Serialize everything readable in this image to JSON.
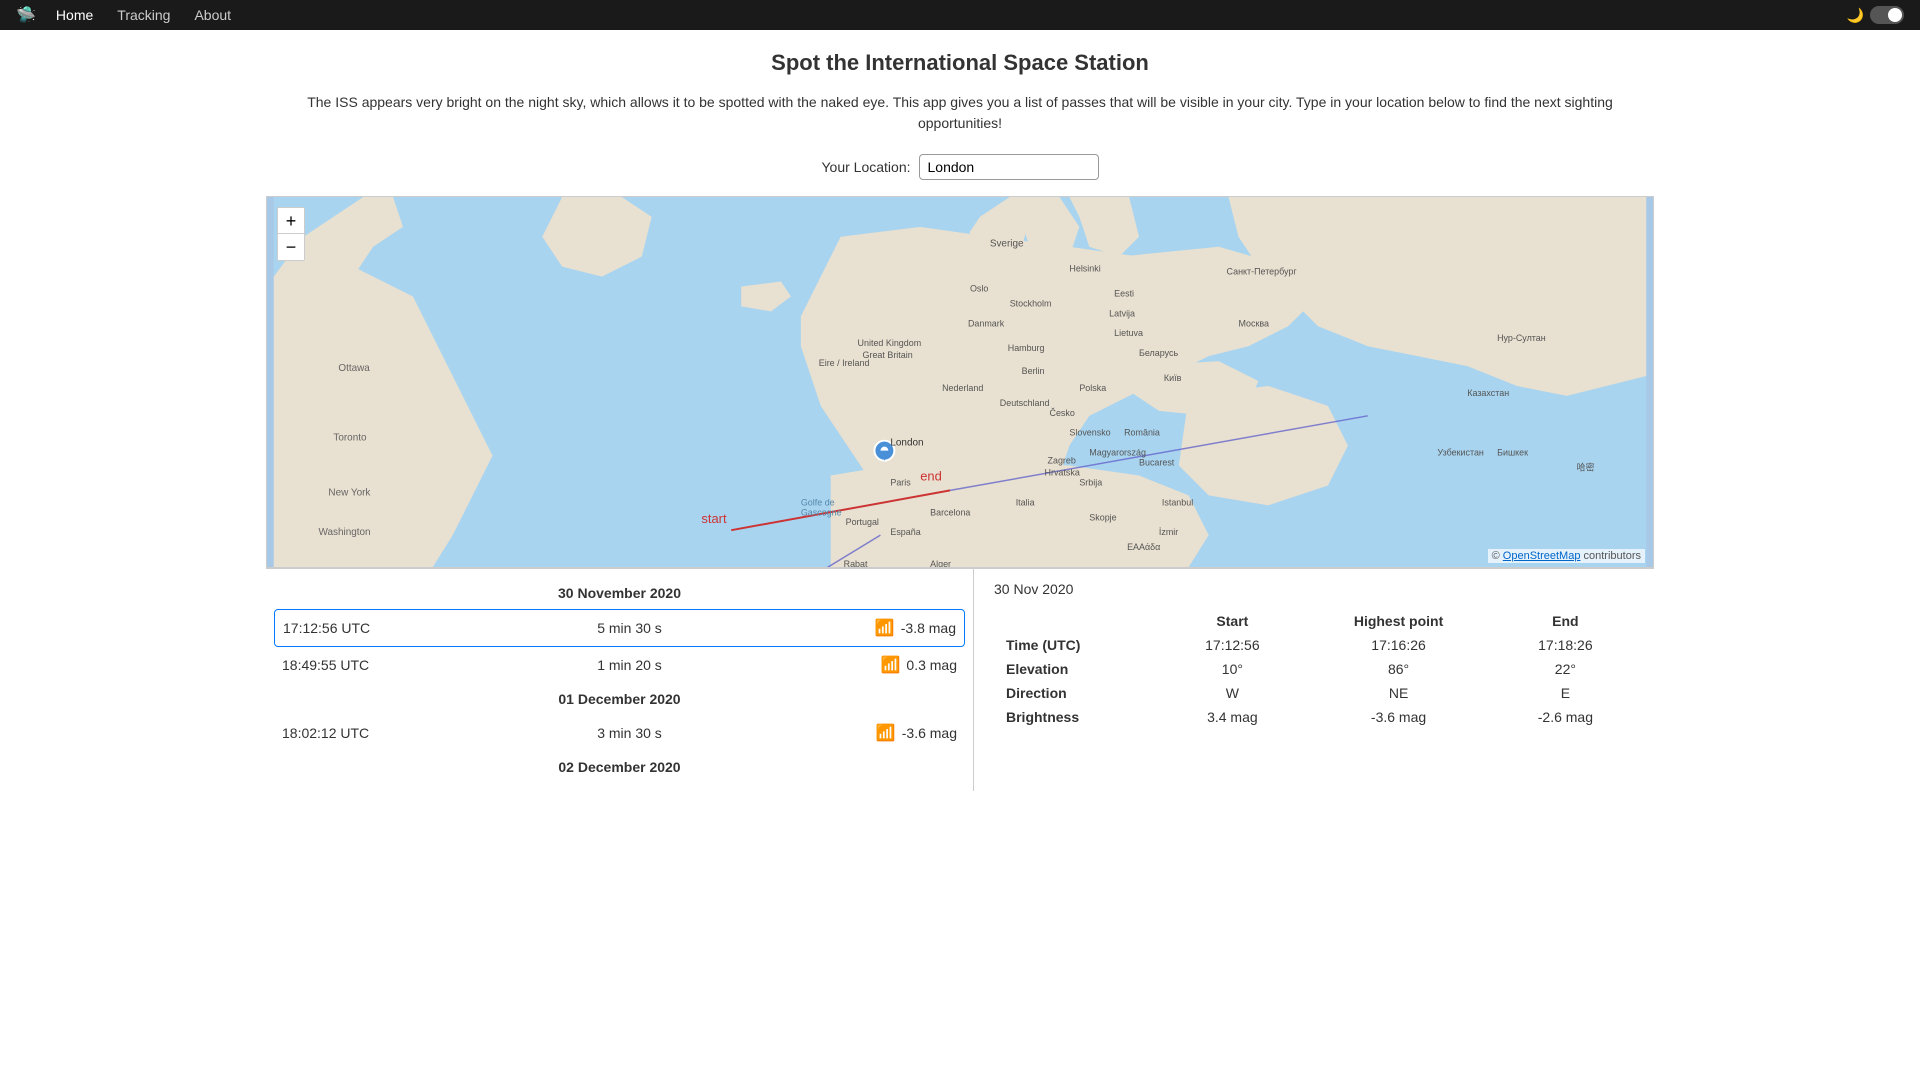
{
  "navbar": {
    "brand_icon": "🛸",
    "home_label": "Home",
    "tracking_label": "Tracking",
    "about_label": "About"
  },
  "page": {
    "title": "Spot the International Space Station",
    "description": "The ISS appears very bright on the night sky, which allows it to be spotted with the naked eye. This app gives you a list of passes that will be visible in your city. Type in your location below to find the next sighting opportunities!",
    "location_label": "Your Location:",
    "location_value": "London"
  },
  "map": {
    "attribution_text": "© OpenStreetMap contributors",
    "zoom_in": "+",
    "zoom_out": "−",
    "start_label": "start",
    "end_label": "end"
  },
  "passes": {
    "dates": [
      {
        "date": "30 November 2020",
        "rows": [
          {
            "time": "17:12:56 UTC",
            "duration": "5 min 30 s",
            "brightness": "-3.8 mag",
            "bright": true,
            "selected": true
          },
          {
            "time": "18:49:55 UTC",
            "duration": "1 min 20 s",
            "brightness": "0.3 mag",
            "bright": false,
            "selected": false
          }
        ]
      },
      {
        "date": "01 December 2020",
        "rows": [
          {
            "time": "18:02:12 UTC",
            "duration": "3 min 30 s",
            "brightness": "-3.6 mag",
            "bright": true,
            "selected": false
          }
        ]
      },
      {
        "date": "02 December 2020",
        "rows": []
      }
    ]
  },
  "detail": {
    "date": "30 Nov 2020",
    "columns": [
      "",
      "Start",
      "Highest point",
      "End"
    ],
    "rows": [
      {
        "label": "Time (UTC)",
        "start": "17:12:56",
        "highest": "17:16:26",
        "end": "17:18:26"
      },
      {
        "label": "Elevation",
        "start": "10°",
        "highest": "86°",
        "end": "22°"
      },
      {
        "label": "Direction",
        "start": "W",
        "highest": "NE",
        "end": "E"
      },
      {
        "label": "Brightness",
        "start": "3.4 mag",
        "highest": "-3.6 mag",
        "end": "-2.6 mag"
      }
    ]
  }
}
